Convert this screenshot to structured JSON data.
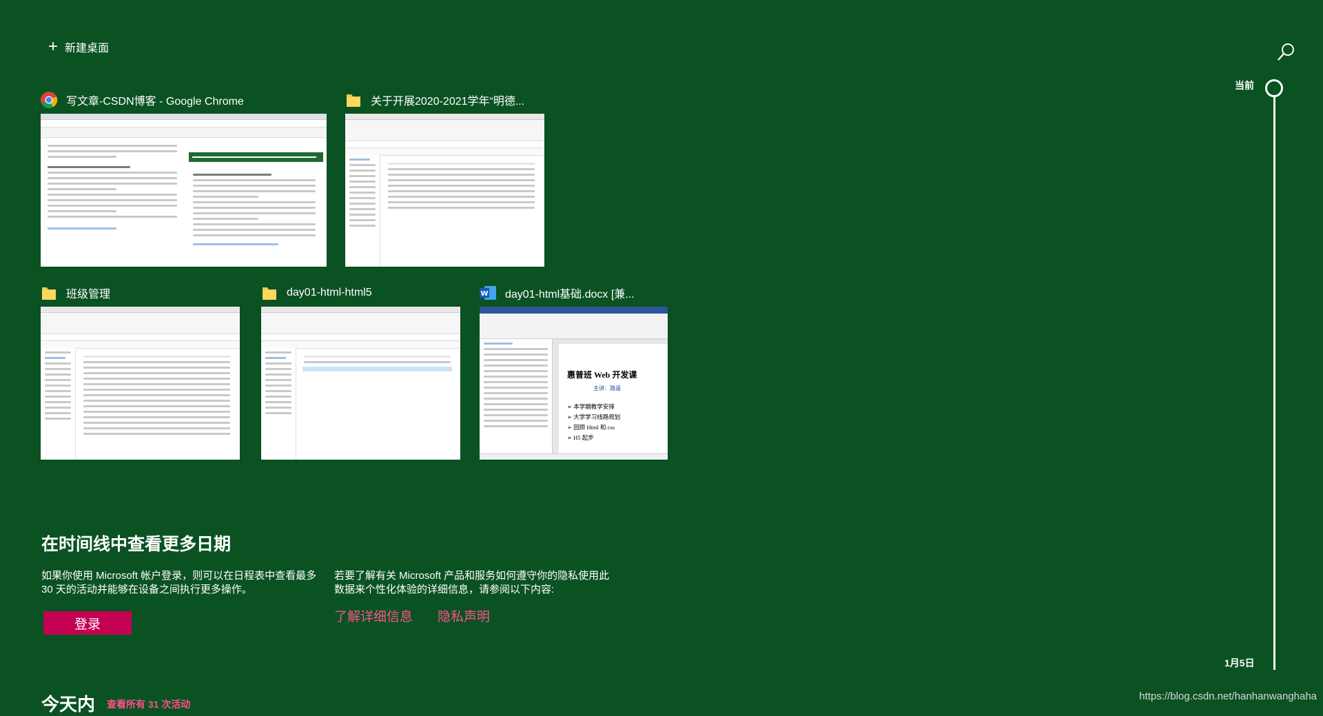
{
  "top": {
    "new_desktop_label": "新建桌面",
    "plus_glyph": "+"
  },
  "windows": [
    {
      "title": "写文章-CSDN博客 - Google Chrome",
      "icon": "chrome-icon"
    },
    {
      "title": "关于开展2020-2021学年“明德...",
      "icon": "folder-icon"
    },
    {
      "title": "班级管理",
      "icon": "folder-icon"
    },
    {
      "title": "day01-html-html5",
      "icon": "folder-icon"
    },
    {
      "title": "day01-html基础.docx [兼...",
      "icon": "word-icon"
    }
  ],
  "word_preview": {
    "heading": "惠普班 Web 开发课",
    "lecturer": "主讲：路遥",
    "bullets": [
      "本学期教学安排",
      "大学学习线路规划",
      "回顾 Html 和 css",
      "H5 起步"
    ]
  },
  "info": {
    "heading": "在时间线中查看更多日期",
    "left_text": "如果你使用 Microsoft 帐户登录，则可以在日程表中查看最多 30 天的活动并能够在设备之间执行更多操作。",
    "right_text": "若要了解有关 Microsoft 产品和服务如何遵守你的隐私使用此数据来个性化体验的详细信息，请参阅以下内容:",
    "login_button": "登录",
    "learn_more_link": "了解详细信息",
    "privacy_link": "隐私声明"
  },
  "today": {
    "heading": "今天内",
    "see_all": "查看所有 31 次活动"
  },
  "timeline": {
    "current_label": "当前",
    "date_label": "1月5日"
  },
  "watermark": "https://blog.csdn.net/hanhanwanghaha",
  "colors": {
    "background": "#0b5223",
    "accent_button": "#c30052",
    "link": "#ff4f8b"
  }
}
